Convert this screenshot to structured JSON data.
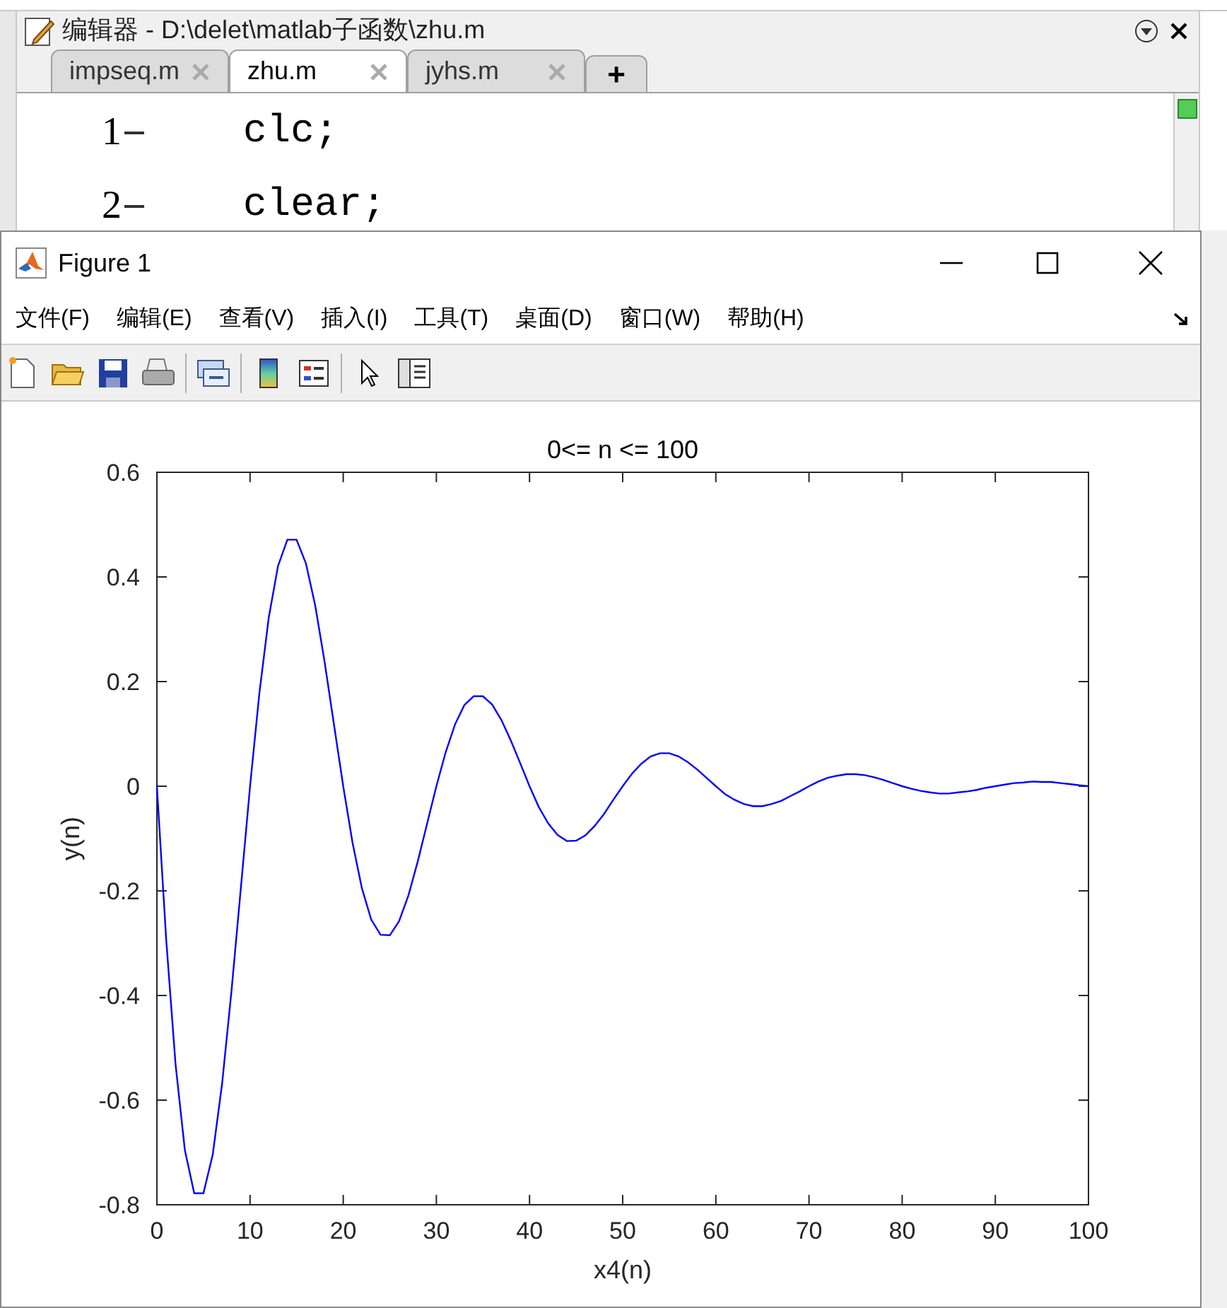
{
  "editor": {
    "title": "编辑器 - D:\\delet\\matlab子函数\\zhu.m",
    "tabs": [
      {
        "label": "impseq.m",
        "selected": false
      },
      {
        "label": "zhu.m",
        "selected": true
      },
      {
        "label": "jyhs.m",
        "selected": false
      }
    ],
    "new_tab": "+",
    "lines": [
      {
        "number": "1",
        "code": "clc;"
      },
      {
        "number": "2",
        "code": "clear;"
      }
    ]
  },
  "figure": {
    "title": "Figure 1",
    "menu": [
      "文件(F)",
      "编辑(E)",
      "查看(V)",
      "插入(I)",
      "工具(T)",
      "桌面(D)",
      "窗口(W)",
      "帮助(H)"
    ],
    "chart_data": {
      "type": "line",
      "title": "0<= n <= 100",
      "xlabel": "x4(n)",
      "ylabel": "y(n)",
      "xlim": [
        0,
        100
      ],
      "ylim": [
        -0.8,
        0.6
      ],
      "xticks": [
        0,
        10,
        20,
        30,
        40,
        50,
        60,
        70,
        80,
        90,
        100
      ],
      "yticks": [
        {
          "value": 0.6,
          "label": "0.6"
        },
        {
          "value": 0.4,
          "label": "0.4"
        },
        {
          "value": 0.2,
          "label": "0.2"
        },
        {
          "value": 0,
          "label": "0"
        },
        {
          "value": -0.2,
          "label": "-0.2"
        },
        {
          "value": -0.4,
          "label": "-0.4"
        },
        {
          "value": -0.6,
          "label": "-0.6"
        },
        {
          "value": -0.8,
          "label": "-0.8"
        }
      ],
      "x": [
        0,
        1,
        2,
        3,
        4,
        5,
        6,
        7,
        8,
        9,
        10,
        11,
        12,
        13,
        14,
        15,
        16,
        17,
        18,
        19,
        20,
        21,
        22,
        23,
        24,
        25,
        26,
        27,
        28,
        29,
        30,
        31,
        32,
        33,
        34,
        35,
        36,
        37,
        38,
        39,
        40,
        41,
        42,
        43,
        44,
        45,
        46,
        47,
        48,
        49,
        50,
        51,
        52,
        53,
        54,
        55,
        56,
        57,
        58,
        59,
        60,
        61,
        62,
        63,
        64,
        65,
        66,
        67,
        68,
        69,
        70,
        71,
        72,
        73,
        74,
        75,
        76,
        77,
        78,
        79,
        80,
        81,
        82,
        83,
        84,
        85,
        86,
        87,
        88,
        89,
        90,
        91,
        92,
        93,
        94,
        95,
        96,
        97,
        98,
        99,
        100
      ],
      "series": [
        {
          "color": "#0000ff",
          "values": [
            0,
            -0.294,
            -0.532,
            -0.696,
            -0.778,
            -0.778,
            -0.704,
            -0.569,
            -0.393,
            -0.197,
            0,
            0.178,
            0.322,
            0.421,
            0.471,
            0.471,
            0.426,
            0.345,
            0.238,
            0.119,
            0,
            -0.108,
            -0.195,
            -0.255,
            -0.284,
            -0.285,
            -0.258,
            -0.209,
            -0.144,
            -0.072,
            0,
            0.065,
            0.118,
            0.155,
            0.172,
            0.172,
            0.156,
            0.126,
            0.087,
            0.044,
            0,
            -0.04,
            -0.071,
            -0.093,
            -0.105,
            -0.104,
            -0.094,
            -0.076,
            -0.053,
            -0.026,
            0,
            0.024,
            0.043,
            0.057,
            0.063,
            0.063,
            0.057,
            0.046,
            0.032,
            0.016,
            0,
            -0.015,
            -0.026,
            -0.034,
            -0.038,
            -0.038,
            -0.034,
            -0.028,
            -0.019,
            -0.01,
            0,
            0.009,
            0.016,
            0.02,
            0.023,
            0.023,
            0.021,
            0.017,
            0.012,
            0.006,
            0,
            -0.005,
            -0.009,
            -0.012,
            -0.014,
            -0.014,
            -0.012,
            -0.01,
            -0.007,
            -0.003,
            0,
            0.003,
            0.006,
            0.007,
            0.009,
            0.008,
            0.008,
            0.006,
            0.004,
            0.002,
            0
          ]
        }
      ]
    }
  }
}
